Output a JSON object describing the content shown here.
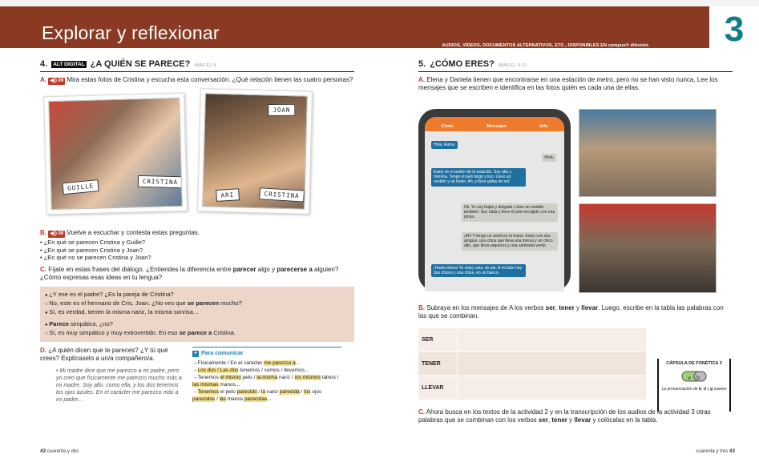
{
  "header": {
    "title": "Explorar y reflexionar",
    "note": "AUDIOS, VÍDEOS, DOCUMENTOS ALTERNATIVOS, ETC., DISPONIBLES EN campus® difusión",
    "unit_number": "3",
    "colors": {
      "band": "#8a3a22",
      "unit": "#0f7e86"
    }
  },
  "section4": {
    "number": "4.",
    "badge": "ALT DIGITAL",
    "title": "¿A QUIÉN SE PARECE?",
    "ref": "/MÁS EJ. 8",
    "a_label": "A.",
    "a_audio": "◀)) 09",
    "a_text": "Mira estas fotos de Cristina y escucha esta conversación. ¿Qué relación tienen las cuatro personas?",
    "photo_tags": [
      "GUILLE",
      "CRISTINA",
      "JOAN",
      "ARI",
      "CRISTINA"
    ],
    "b_label": "B.",
    "b_audio": "◀)) 09",
    "b_text": "Vuelve a escuchar y contesta estas preguntas.",
    "b_questions": [
      "¿En qué se parecen Cristina y Guille?",
      "¿En qué se parecen Cristina y Joan?",
      "¿En qué no se parecen Cristina y Joan?"
    ],
    "c_label": "C.",
    "c_text_1": "Fíjate en estas frases del diálogo. ¿Entiendes la diferencia entre ",
    "c_strong_1": "parecer",
    "c_text_2": " algo y ",
    "c_strong_2": "parecerse a",
    "c_text_3": " alguien? ¿Cómo expresas esas ideas en tu lengua?",
    "dialogue": {
      "l1": "¿Y ese es el padre? ¿Es la pareja de Cristina?",
      "l2a": "No, este es el hermano de Cris, Joan. ¿No ves que ",
      "l2b": "se parecen",
      "l2c": " mucho?",
      "l3": "Sí, es verdad, tienen la misma nariz, la misma sonrisa...",
      "l4a": "Parece",
      "l4b": " simpático, ¿no?",
      "l5a": "Sí, es muy simpático y muy extrovertido. En eso ",
      "l5b": "se parece a",
      "l5c": " Cristina."
    },
    "d_label": "D.",
    "d_text": "¿A quién dicen que te pareces? ¿Y tú qué crees? Explícaselo a un/a compañero/a.",
    "d_sample": "Mi madre dice que me parezco a mi padre, pero yo creo que físicamente me parezco mucho más a mi madre. Soy alto, como ella, y los dos tenemos los ojos azules. En el carácter me parezco más a mi padre...",
    "comm_title": "Para comunicar",
    "comm": {
      "i1a": "Físicamente / En el carácter ",
      "i1b": "me parezco a",
      "i1c": "...",
      "i2a": "Los dos / Las dos",
      "i2b": " tenemos / somos / llevamos...",
      "i3a": "Tenemos ",
      "i3b": "el mismo",
      "i3c": " pelo / ",
      "i3d": "la misma",
      "i3e": " nariz / ",
      "i3f": "los mismos",
      "i3g": " labios / ",
      "i3h": "las mismas",
      "i3i": " manos...",
      "i4a": "Tenemos",
      "i4b": " el pelo ",
      "i4c": "parecido",
      "i4d": " / ",
      "i4e": "la",
      "i4f": " nariz ",
      "i4g": "parecida",
      "i4h": " / ",
      "i4i": "los",
      "i4j": " ojos ",
      "i4k": "parecidos",
      "i4l": " / ",
      "i4m": "las",
      "i4n": " manos ",
      "i4o": "parecidas",
      "i4p": "..."
    }
  },
  "section5": {
    "number": "5.",
    "title": "¿CÓMO ERES?",
    "ref": "/MÁS EJ. 9-11",
    "a_label": "A.",
    "a_text": "Elena y Daniela tienen que encontrarse en una estación de metro, pero no se han visto nunca. Lee los mensajes que se escriben e identifica en las fotos quién es cada una de ellas.",
    "phone_tabs": [
      "Chats",
      "Mensajes",
      "Info"
    ],
    "messages": [
      "Hola, Elena.",
      "Hola.",
      "Estoy en el andén de la estación. Soy alta y morena. Tengo el pelo largo y liso. Llevo un vestido y un bolso. Ah, y llevo gafas de sol.",
      "Ok. Yo soy bajita y delgada. Llevo un vestido también. Soy rubia y llevo el pelo recogido con una pinza.",
      "¡Ah! Y tengo un móvil en la mano. Estoy con dos amigos, una chica que lleva una trenza y un chico alto, que lleva vaqueros y una camiseta verde.",
      "¡Hasta ahora! Yo estoy sola, de pie. A mi lado hay dos chicos y una chica, en un banco."
    ],
    "b_label": "B.",
    "b_text_1": "Subraya en los mensajes de A los verbos ",
    "b_v1": "ser",
    "b_text_2": ", ",
    "b_v2": "tener",
    "b_text_3": " y ",
    "b_v3": "llevar",
    "b_text_4": ". Luego, escribe en la tabla las palabras con las que se combinan.",
    "table_rows": [
      "SER",
      "TENER",
      "LLEVAR"
    ],
    "phonetics": {
      "title": "CÁPSULA DE FONÉTICA 3",
      "sub_1": "La pronunciación de ",
      "sub_b": "b",
      "sub_2": ", ",
      "sub_d": "d",
      "sub_3": " y ",
      "sub_g": "g",
      "sub_4": " suaves"
    },
    "c_label": "C.",
    "c_text_1": "Ahora busca en los textos de la actividad 2 y en la transcripción de los audios de la actividad 3 otras palabras que se combinan con los verbos ",
    "c_v1": "ser",
    "c_text_2": ", ",
    "c_v2": "tener",
    "c_text_3": " y ",
    "c_v3": "llevar",
    "c_text_4": " y colócalas en la tabla."
  },
  "footer": {
    "left_num": "42",
    "left_word": "cuarenta y dos",
    "right_word": "cuarenta y tres",
    "right_num": "43"
  }
}
